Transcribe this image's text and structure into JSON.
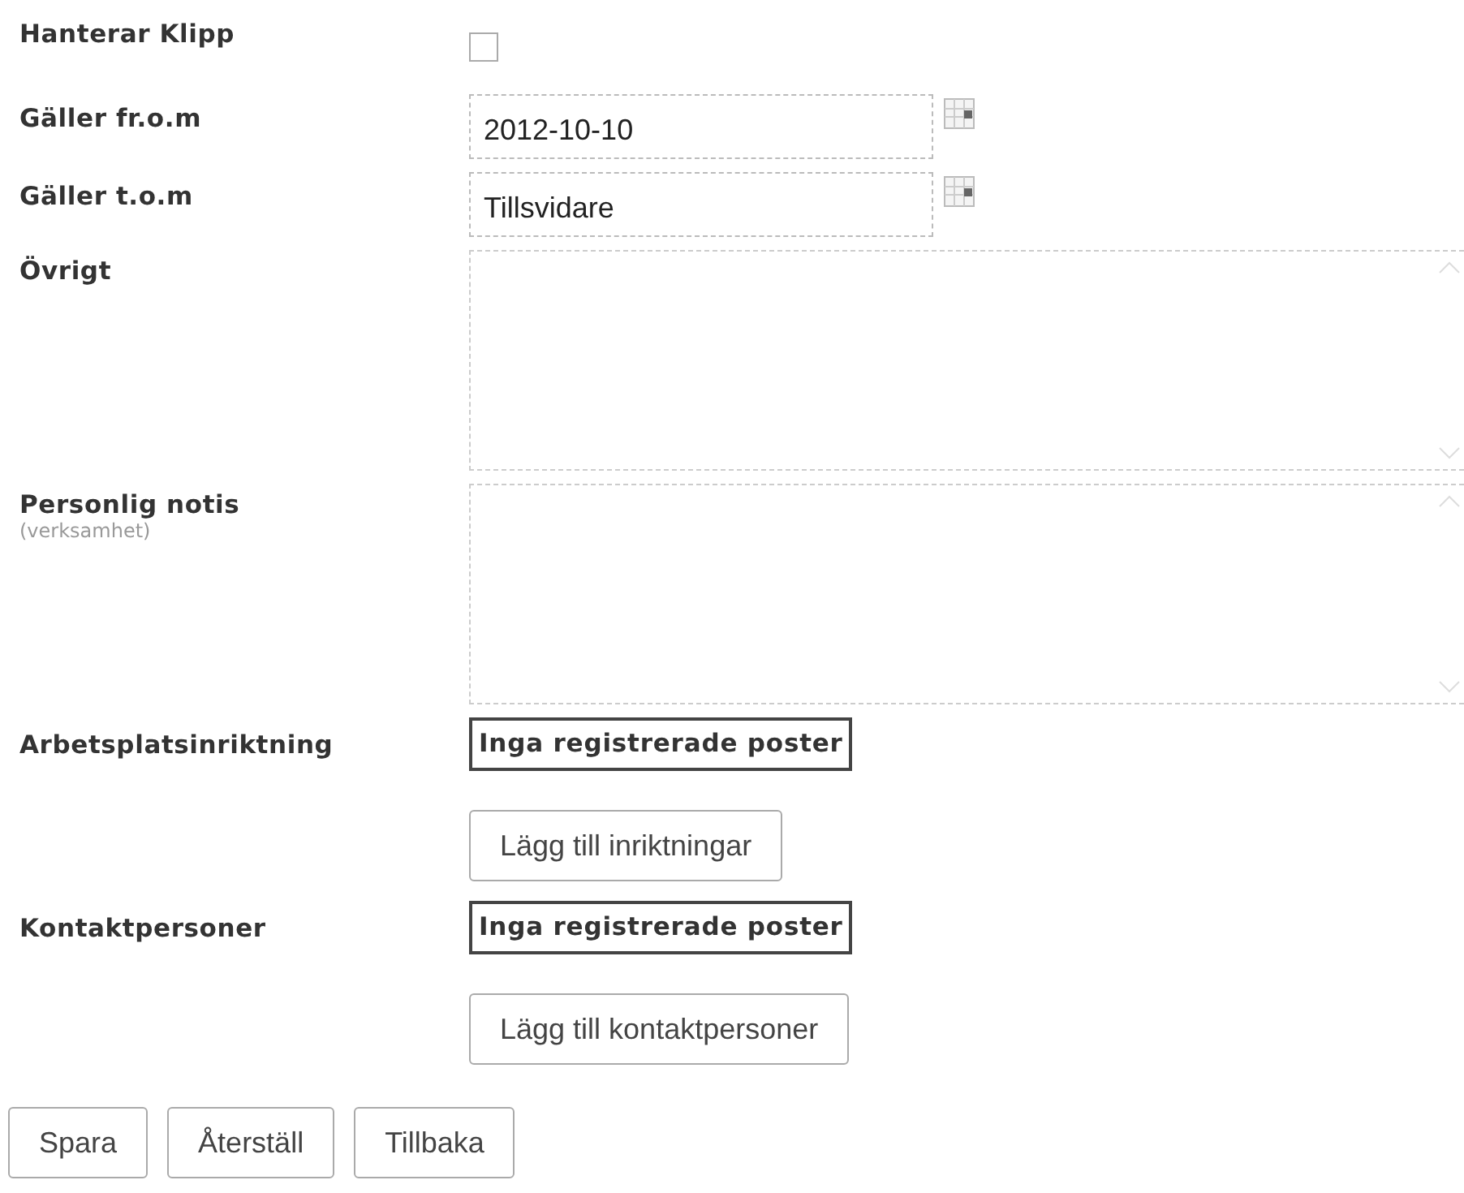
{
  "fields": [
    {
      "kind": "checkbox",
      "label": "Hanterar Klipp",
      "checked": false
    },
    {
      "kind": "date",
      "label": "Gäller fr.o.m",
      "value": "2012-10-10"
    },
    {
      "kind": "date",
      "label": "Gäller t.o.m",
      "value": "Tillsvidare"
    },
    {
      "kind": "textarea",
      "label": "Övrigt"
    },
    {
      "kind": "textarea",
      "label": "Personlig notis",
      "sublabel": "(verksamhet)"
    },
    {
      "kind": "list",
      "label": "Arbetsplatsinriktning",
      "empty_text": "Inga registrerade poster",
      "button": "Lägg till inriktningar"
    },
    {
      "kind": "list",
      "label": "Kontaktpersoner",
      "empty_text": "Inga registrerade poster",
      "button": "Lägg till kontaktpersoner"
    }
  ],
  "buttons": [
    "Spara",
    "Återställ",
    "Tillbaka"
  ]
}
